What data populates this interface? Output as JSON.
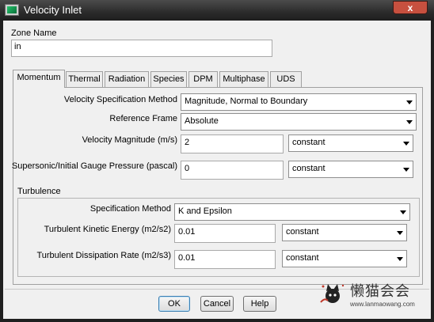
{
  "window": {
    "title": "Velocity Inlet",
    "close_glyph": "x"
  },
  "zone": {
    "label": "Zone Name",
    "value": "in"
  },
  "tabs": [
    {
      "label": "Momentum",
      "active": true
    },
    {
      "label": "Thermal"
    },
    {
      "label": "Radiation"
    },
    {
      "label": "Species"
    },
    {
      "label": "DPM"
    },
    {
      "label": "Multiphase"
    },
    {
      "label": "UDS"
    }
  ],
  "momentum": {
    "velocity_spec_label": "Velocity Specification Method",
    "velocity_spec_value": "Magnitude, Normal to Boundary",
    "reference_frame_label": "Reference Frame",
    "reference_frame_value": "Absolute",
    "velocity_magnitude_label": "Velocity Magnitude (m/s)",
    "velocity_magnitude_value": "2",
    "velocity_magnitude_profile": "constant",
    "gauge_pressure_label": "Supersonic/Initial Gauge Pressure (pascal)",
    "gauge_pressure_value": "0",
    "gauge_pressure_profile": "constant"
  },
  "turbulence": {
    "title": "Turbulence",
    "spec_method_label": "Specification Method",
    "spec_method_value": "K and Epsilon",
    "tke_label": "Turbulent Kinetic Energy (m2/s2)",
    "tke_value": "0.01",
    "tke_profile": "constant",
    "tdr_label": "Turbulent Dissipation Rate (m2/s3)",
    "tdr_value": "0.01",
    "tdr_profile": "constant"
  },
  "buttons": {
    "ok": "OK",
    "cancel": "Cancel",
    "help": "Help"
  },
  "watermark": {
    "title": "懒猫会会",
    "url": "www.lanmaowang.com"
  }
}
